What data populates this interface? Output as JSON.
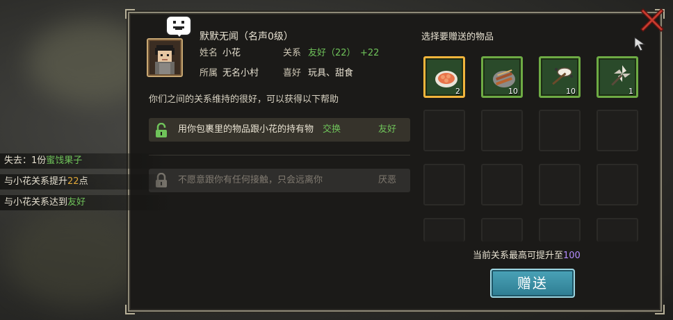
{
  "npc": {
    "title": "默默无闻（名声0级）",
    "name_label": "姓名",
    "name_value": "小花",
    "relation_label": "关系",
    "relation_value": "友好（22）",
    "relation_delta": "+22",
    "belong_label": "所属",
    "belong_value": "无名小村",
    "likes_label": "喜好",
    "likes_value": "玩具、甜食"
  },
  "help_text": "你们之间的关系维持的很好，可以获得以下帮助",
  "options": [
    {
      "text_prefix": "用你包裹里的物品跟小花的持有物",
      "text_action": "交换",
      "status": "友好",
      "locked": false
    },
    {
      "text_prefix": "不愿意跟你有任何接触，只会远离你",
      "text_action": "",
      "status": "厌恶",
      "locked": true
    }
  ],
  "gift_title": "选择要赠送的物品",
  "items": [
    {
      "icon": "shrimp-dish-icon",
      "count": "2",
      "selected": true
    },
    {
      "icon": "grilled-skewers-icon",
      "count": "10",
      "selected": false
    },
    {
      "icon": "drum-toy-icon",
      "count": "10",
      "selected": false
    },
    {
      "icon": "pinwheel-icon",
      "count": "1",
      "selected": false
    }
  ],
  "max_text_prefix": "当前关系最高可提升至",
  "max_value": "100",
  "gift_button": "赠送",
  "log": [
    {
      "prefix": "失去：1份",
      "highlight": "蜜饯果子",
      "suffix": "",
      "color": "#6fc35a"
    },
    {
      "prefix": "与小花关系提升",
      "highlight": "22",
      "suffix": "点",
      "color": "#e0a83a"
    },
    {
      "prefix": "与小花关系达到",
      "highlight": "友好",
      "suffix": "",
      "color": "#6fc35a"
    }
  ],
  "colors": {
    "accent_green": "#6fc35a",
    "accent_orange": "#e0a83a",
    "frame": "#8f8a78",
    "button": "#2e7c92"
  }
}
